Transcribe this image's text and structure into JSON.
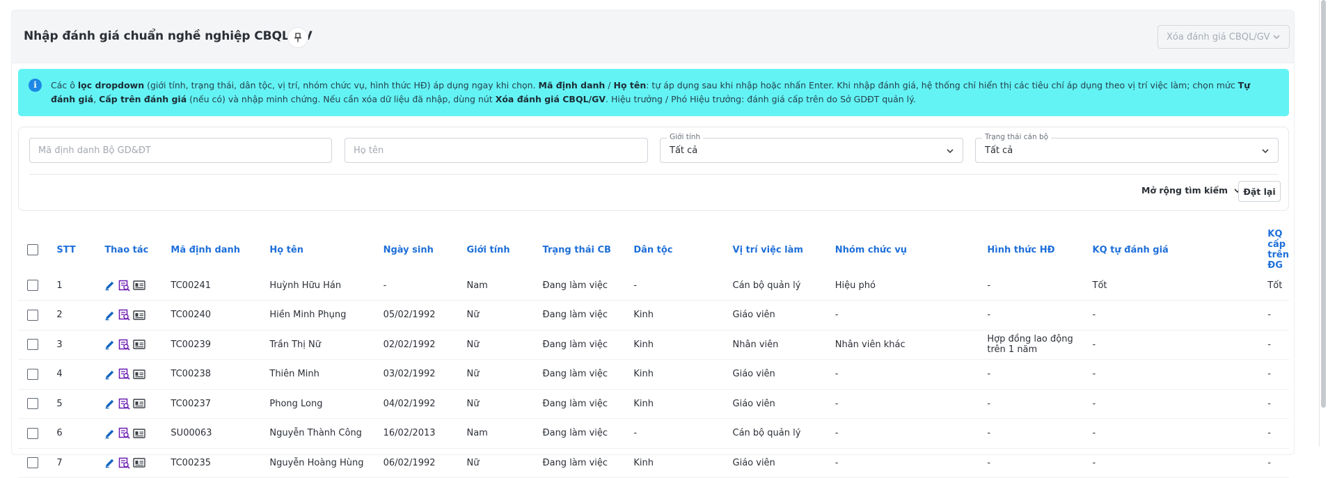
{
  "header": {
    "title": "Nhập đánh giá chuẩn nghề nghiệp CBQL/GV",
    "delete_label": "Xóa đánh giá CBQL/GV"
  },
  "info": {
    "p1": "Các ô ",
    "b1": "lọc dropdown",
    "p2": " (giới tính, trạng thái, dân tộc, vị trí, nhóm chức vụ, hình thức HĐ) áp dụng ngay khi chọn. ",
    "b2": "Mã định danh",
    "p3": " / ",
    "b3": "Họ tên",
    "p4": ": tự áp dụng sau khi nhập hoặc nhấn Enter. Khi nhập đánh giá, hệ thống chỉ hiển thị các tiêu chí áp dụng theo vị trí việc làm; chọn mức ",
    "b4": "Tự đánh giá",
    "p5": ", ",
    "b5": "Cấp trên đánh giá",
    "p6": " (nếu có) và nhập minh chứng. Nếu cần xóa dữ liệu đã nhập, dùng nút ",
    "b6": "Xóa đánh giá CBQL/GV",
    "p7": ". Hiệu trưởng / Phó Hiệu trưởng: đánh giá cấp trên do Sở GDĐT quản lý."
  },
  "filters": {
    "code_placeholder": "Mã định danh Bộ GD&ĐT",
    "name_placeholder": "Họ tên",
    "gender_label": "Giới tính",
    "gender_value": "Tất cả",
    "status_label": "Trạng thái cán bộ",
    "status_value": "Tất cả",
    "expand_label": "Mở rộng tìm kiếm",
    "reset_label": "Đặt lại"
  },
  "table": {
    "columns": [
      "STT",
      "Thao tác",
      "Mã định danh",
      "Họ tên",
      "Ngày sinh",
      "Giới tính",
      "Trạng thái CB",
      "Dân tộc",
      "Vị trí việc làm",
      "Nhóm chức vụ",
      "Hình thức HĐ",
      "KQ tự đánh giá",
      "KQ cấp trên ĐG"
    ],
    "rows": [
      [
        "1",
        "TC00241",
        "Huỳnh Hữu Hán",
        "-",
        "Nam",
        "Đang làm việc",
        "-",
        "Cán bộ quản lý",
        "Hiệu phó",
        "-",
        "Tốt",
        "Tốt"
      ],
      [
        "2",
        "TC00240",
        "Hiền Minh Phụng",
        "05/02/1992",
        "Nữ",
        "Đang làm việc",
        "Kinh",
        "Giáo viên",
        "-",
        "-",
        "-",
        "-"
      ],
      [
        "3",
        "TC00239",
        "Trần Thị Nữ",
        "02/02/1992",
        "Nữ",
        "Đang làm việc",
        "Kinh",
        "Nhân viên",
        "Nhân viên khác",
        "Hợp đồng lao động trên 1 năm",
        "-",
        "-"
      ],
      [
        "4",
        "TC00238",
        "Thiên Minh",
        "03/02/1992",
        "Nữ",
        "Đang làm việc",
        "Kinh",
        "Giáo viên",
        "-",
        "-",
        "-",
        "-"
      ],
      [
        "5",
        "TC00237",
        "Phong Long",
        "04/02/1992",
        "Nữ",
        "Đang làm việc",
        "Kinh",
        "Giáo viên",
        "-",
        "-",
        "-",
        "-"
      ],
      [
        "6",
        "SU00063",
        "Nguyễn Thành Công",
        "16/02/2013",
        "Nam",
        "Đang làm việc",
        "-",
        "Cán bộ quản lý",
        "-",
        "-",
        "-",
        "-"
      ],
      [
        "7",
        "TC00235",
        "Nguyễn Hoàng Hùng",
        "06/02/1992",
        "Nữ",
        "Đang làm việc",
        "Kinh",
        "Giáo viên",
        "-",
        "-",
        "-",
        "-"
      ]
    ]
  },
  "colors": {
    "accent": "#1e6fd9",
    "info_bg": "#64f3f4",
    "icon_blue": "#1565c0",
    "icon_purple": "#6a1bb1"
  },
  "icons": [
    "pin-icon",
    "chevron-down-icon",
    "info-icon",
    "edit-icon",
    "review-icon",
    "profile-card-icon"
  ]
}
